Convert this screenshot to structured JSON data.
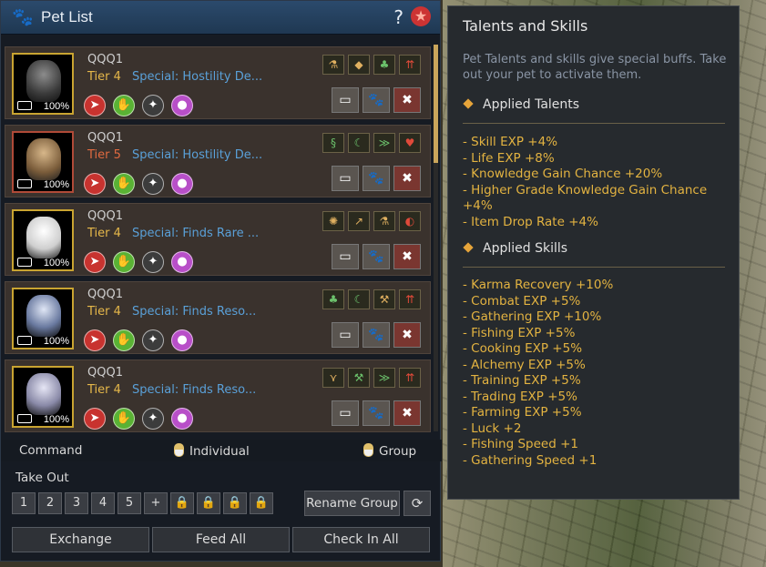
{
  "window": {
    "title": "Pet List",
    "help": "?",
    "accent": "#c9a431"
  },
  "pets": [
    {
      "name": "QQQ1",
      "tier": "Tier 4",
      "special": "Special: Hostility De...",
      "hunger": "100%",
      "tier_color": "#e6b84a",
      "talent_icons": [
        "flask-icon",
        "bag-icon",
        "clover-icon",
        "arrow-up-icon"
      ]
    },
    {
      "name": "QQQ1",
      "tier": "Tier 5",
      "special": "Special: Hostility De...",
      "hunger": "100%",
      "tier_color": "#e06a40",
      "talent_icons": [
        "dragon-icon",
        "sickle-icon",
        "wing-icon",
        "heart-icon"
      ]
    },
    {
      "name": "QQQ1",
      "tier": "Tier 4",
      "special": "Special: Finds Rare ...",
      "hunger": "100%",
      "tier_color": "#e6b84a",
      "talent_icons": [
        "crab-icon",
        "arrow-rise-icon",
        "flask-icon",
        "shield-icon"
      ]
    },
    {
      "name": "QQQ1",
      "tier": "Tier 4",
      "special": "Special: Finds Reso...",
      "hunger": "100%",
      "tier_color": "#e6b84a",
      "talent_icons": [
        "clover-icon",
        "sickle-icon",
        "pickaxe-icon",
        "arrow-up-icon"
      ]
    },
    {
      "name": "QQQ1",
      "tier": "Tier 4",
      "special": "Special: Finds Reso...",
      "hunger": "100%",
      "tier_color": "#e6b84a",
      "talent_icons": [
        "wheat-icon",
        "pickaxe-icon",
        "wing-icon",
        "arrow-up-icon"
      ]
    }
  ],
  "command": {
    "label": "Command",
    "individual": "Individual",
    "group": "Group"
  },
  "takeout": {
    "label": "Take Out",
    "slots": [
      "1",
      "2",
      "3",
      "4",
      "5",
      "+"
    ],
    "rename": "Rename Group"
  },
  "buttons": {
    "exchange": "Exchange",
    "feed_all": "Feed All",
    "check_in_all": "Check In All"
  },
  "tooltip": {
    "title": "Talents and Skills",
    "description": "Pet Talents and skills give special buffs. Take out your pet to activate them.",
    "talents_header": "Applied Talents",
    "talents": [
      "- Skill EXP +4%",
      "- Life EXP +8%",
      "- Knowledge Gain Chance +20%",
      "- Higher Grade Knowledge Gain Chance",
      "+4%",
      "- Item Drop Rate +4%"
    ],
    "skills_header": "Applied Skills",
    "skills": [
      "- Karma Recovery +10%",
      "- Combat EXP +5%",
      "- Gathering EXP +10%",
      "- Fishing EXP +5%",
      "- Cooking EXP +5%",
      "- Alchemy EXP +5%",
      "- Training EXP +5%",
      "- Trading EXP +5%",
      "- Farming EXP +5%",
      "- Luck +2",
      "- Fishing Speed +1",
      "- Gathering Speed +1"
    ]
  }
}
